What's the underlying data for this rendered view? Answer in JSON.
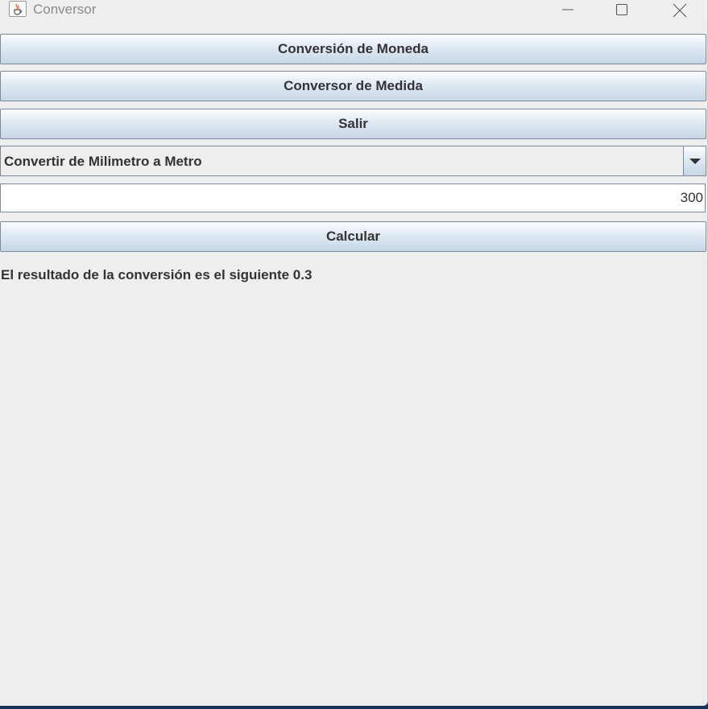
{
  "window": {
    "title": "Conversor",
    "icon": "java-cup-icon",
    "controls": [
      "minimize-icon",
      "maximize-icon",
      "close-icon"
    ]
  },
  "buttons": {
    "currency": "Conversión de Moneda",
    "measure": "Conversor de Medida",
    "exit": "Salir",
    "calculate": "Calcular"
  },
  "combo": {
    "selected": "Convertir de Milimetro a Metro",
    "arrow_icon": "chevron-down-icon"
  },
  "input": {
    "value": "300"
  },
  "result": {
    "text": "El resultado de la conversión es el siguiente 0.3"
  },
  "colors": {
    "window_bg": "#eeeeee",
    "button_gradient_top": "#fbfdfe",
    "button_gradient_bottom": "#c7d6e6",
    "border": "#7a8a99",
    "text": "#333333"
  }
}
